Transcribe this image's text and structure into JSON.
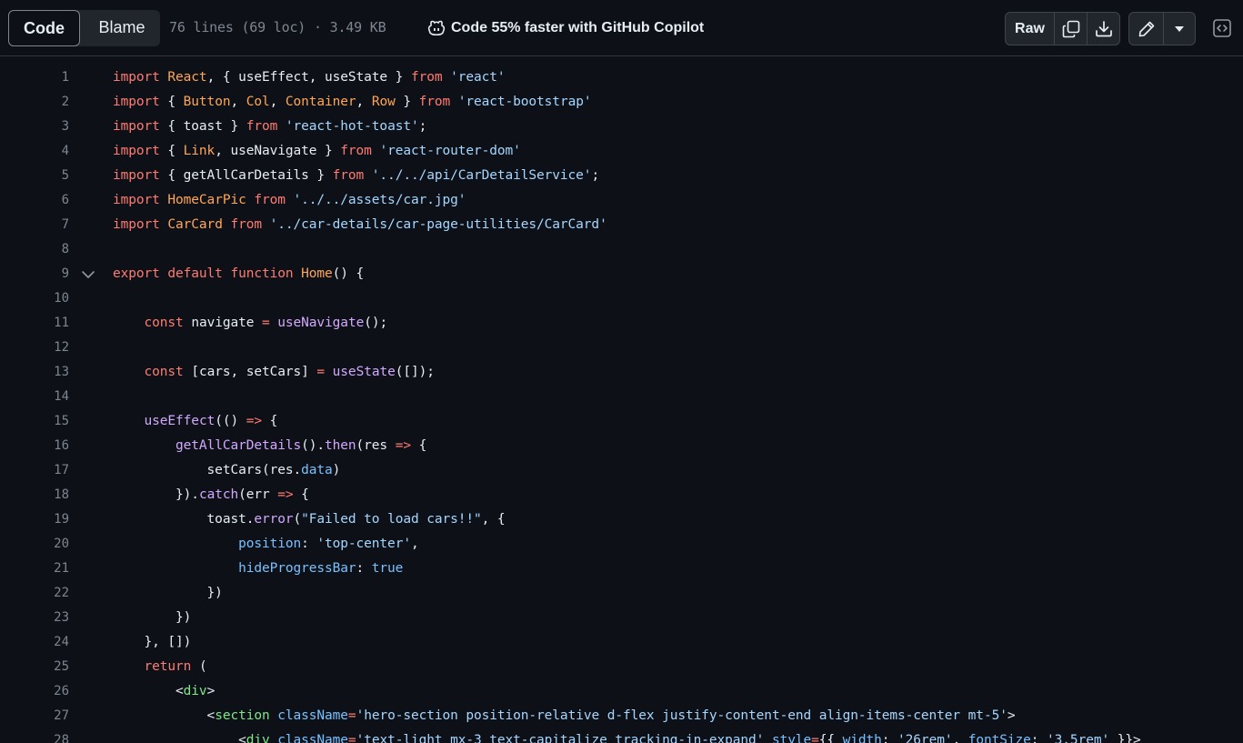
{
  "toolbar": {
    "tab_code": "Code",
    "tab_blame": "Blame",
    "file_info": "76 lines (69 loc) · 3.49 KB",
    "copilot_promo": "Code 55% faster with GitHub Copilot",
    "raw_label": "Raw",
    "icons": [
      "copilot-icon",
      "copy-icon",
      "download-icon",
      "pencil-icon",
      "triangle-down-icon",
      "code-symbols-icon",
      "chevron-down-icon"
    ]
  },
  "code": {
    "lines": [
      {
        "n": "1",
        "segs": [
          [
            "k",
            "import"
          ],
          [
            "",
            ""
          ],
          [
            "o",
            " React"
          ],
          [
            "",
            ", { useEffect, useState } "
          ],
          [
            "k",
            "from"
          ],
          [
            "s",
            " 'react'"
          ]
        ]
      },
      {
        "n": "2",
        "segs": [
          [
            "k",
            "import"
          ],
          [
            "",
            " { "
          ],
          [
            "o",
            "Button"
          ],
          [
            "",
            ", "
          ],
          [
            "o",
            "Col"
          ],
          [
            "",
            ", "
          ],
          [
            "o",
            "Container"
          ],
          [
            "",
            ", "
          ],
          [
            "o",
            "Row"
          ],
          [
            "",
            " } "
          ],
          [
            "k",
            "from"
          ],
          [
            "s",
            " 'react-bootstrap'"
          ]
        ]
      },
      {
        "n": "3",
        "segs": [
          [
            "k",
            "import"
          ],
          [
            "",
            " { toast } "
          ],
          [
            "k",
            "from"
          ],
          [
            "s",
            " 'react-hot-toast'"
          ],
          [
            "",
            ";"
          ]
        ]
      },
      {
        "n": "4",
        "segs": [
          [
            "k",
            "import"
          ],
          [
            "",
            " { "
          ],
          [
            "o",
            "Link"
          ],
          [
            "",
            ", useNavigate } "
          ],
          [
            "k",
            "from"
          ],
          [
            "s",
            " 'react-router-dom'"
          ]
        ]
      },
      {
        "n": "5",
        "segs": [
          [
            "k",
            "import"
          ],
          [
            "",
            " { getAllCarDetails } "
          ],
          [
            "k",
            "from"
          ],
          [
            "s",
            " '../../api/CarDetailService'"
          ],
          [
            "",
            ";"
          ]
        ]
      },
      {
        "n": "6",
        "segs": [
          [
            "k",
            "import"
          ],
          [
            "o",
            " HomeCarPic"
          ],
          [
            "k",
            " from"
          ],
          [
            "s",
            " '../../assets/car.jpg'"
          ]
        ]
      },
      {
        "n": "7",
        "segs": [
          [
            "k",
            "import"
          ],
          [
            "o",
            " CarCard"
          ],
          [
            "k",
            " from"
          ],
          [
            "s",
            " '../car-details/car-page-utilities/CarCard'"
          ]
        ]
      },
      {
        "n": "8",
        "segs": []
      },
      {
        "n": "9",
        "fold": true,
        "segs": [
          [
            "k",
            "export default function"
          ],
          [
            "o",
            " Home"
          ],
          [
            "",
            "() {"
          ]
        ]
      },
      {
        "n": "10",
        "segs": []
      },
      {
        "n": "11",
        "segs": [
          [
            "",
            "    "
          ],
          [
            "k",
            "const"
          ],
          [
            "",
            " navigate "
          ],
          [
            "k",
            "="
          ],
          [
            "f",
            " useNavigate"
          ],
          [
            "",
            "();"
          ]
        ]
      },
      {
        "n": "12",
        "segs": []
      },
      {
        "n": "13",
        "segs": [
          [
            "",
            "    "
          ],
          [
            "k",
            "const"
          ],
          [
            "",
            " [cars, setCars] "
          ],
          [
            "k",
            "="
          ],
          [
            "f",
            " useState"
          ],
          [
            "",
            "([]);"
          ]
        ]
      },
      {
        "n": "14",
        "segs": []
      },
      {
        "n": "15",
        "segs": [
          [
            "",
            "    "
          ],
          [
            "f",
            "useEffect"
          ],
          [
            "",
            "(() "
          ],
          [
            "k",
            "=>"
          ],
          [
            "",
            " {"
          ]
        ]
      },
      {
        "n": "16",
        "segs": [
          [
            "",
            "        "
          ],
          [
            "f",
            "getAllCarDetails"
          ],
          [
            "",
            "()."
          ],
          [
            "f",
            "then"
          ],
          [
            "",
            "(res "
          ],
          [
            "k",
            "=>"
          ],
          [
            "",
            " {"
          ]
        ]
      },
      {
        "n": "17",
        "segs": [
          [
            "",
            "            setCars(res."
          ],
          [
            "c",
            "data"
          ],
          [
            "",
            ")"
          ]
        ]
      },
      {
        "n": "18",
        "segs": [
          [
            "",
            "        })."
          ],
          [
            "f",
            "catch"
          ],
          [
            "",
            "(err "
          ],
          [
            "k",
            "=>"
          ],
          [
            "",
            " {"
          ]
        ]
      },
      {
        "n": "19",
        "segs": [
          [
            "",
            "            toast."
          ],
          [
            "f",
            "error"
          ],
          [
            "",
            "("
          ],
          [
            "s",
            "\"Failed to load cars!!\""
          ],
          [
            "",
            ", {"
          ]
        ]
      },
      {
        "n": "20",
        "segs": [
          [
            "",
            "                "
          ],
          [
            "c",
            "position"
          ],
          [
            "",
            ": "
          ],
          [
            "s",
            "'top-center'"
          ],
          [
            "",
            ","
          ]
        ]
      },
      {
        "n": "21",
        "segs": [
          [
            "",
            "                "
          ],
          [
            "c",
            "hideProgressBar"
          ],
          [
            "",
            ": "
          ],
          [
            "c",
            "true"
          ]
        ]
      },
      {
        "n": "22",
        "segs": [
          [
            "",
            "            })"
          ]
        ]
      },
      {
        "n": "23",
        "segs": [
          [
            "",
            "        })"
          ]
        ]
      },
      {
        "n": "24",
        "segs": [
          [
            "",
            "    }, [])"
          ]
        ]
      },
      {
        "n": "25",
        "segs": [
          [
            "",
            "    "
          ],
          [
            "k",
            "return"
          ],
          [
            "",
            " ("
          ]
        ]
      },
      {
        "n": "26",
        "segs": [
          [
            "",
            "        <"
          ],
          [
            "t",
            "div"
          ],
          [
            "",
            ">"
          ]
        ]
      },
      {
        "n": "27",
        "segs": [
          [
            "",
            "            <"
          ],
          [
            "t",
            "section"
          ],
          [
            "c",
            " className"
          ],
          [
            "k",
            "="
          ],
          [
            "s",
            "'hero-section position-relative d-flex justify-content-end align-items-center mt-5'"
          ],
          [
            "",
            ">"
          ]
        ]
      },
      {
        "n": "28",
        "segs": [
          [
            "",
            "                <"
          ],
          [
            "t",
            "div"
          ],
          [
            "c",
            " className"
          ],
          [
            "k",
            "="
          ],
          [
            "s",
            "'text-light mx-3 text-capitalize tracking-in-expand'"
          ],
          [
            "c",
            " style"
          ],
          [
            "k",
            "="
          ],
          [
            "",
            "{{ "
          ],
          [
            "c",
            "width"
          ],
          [
            "",
            ": "
          ],
          [
            "s",
            "'26rem'"
          ],
          [
            "",
            ", "
          ],
          [
            "c",
            "fontSize"
          ],
          [
            "",
            ": "
          ],
          [
            "s",
            "'3.5rem'"
          ],
          [
            "",
            " }}>"
          ]
        ]
      }
    ]
  }
}
